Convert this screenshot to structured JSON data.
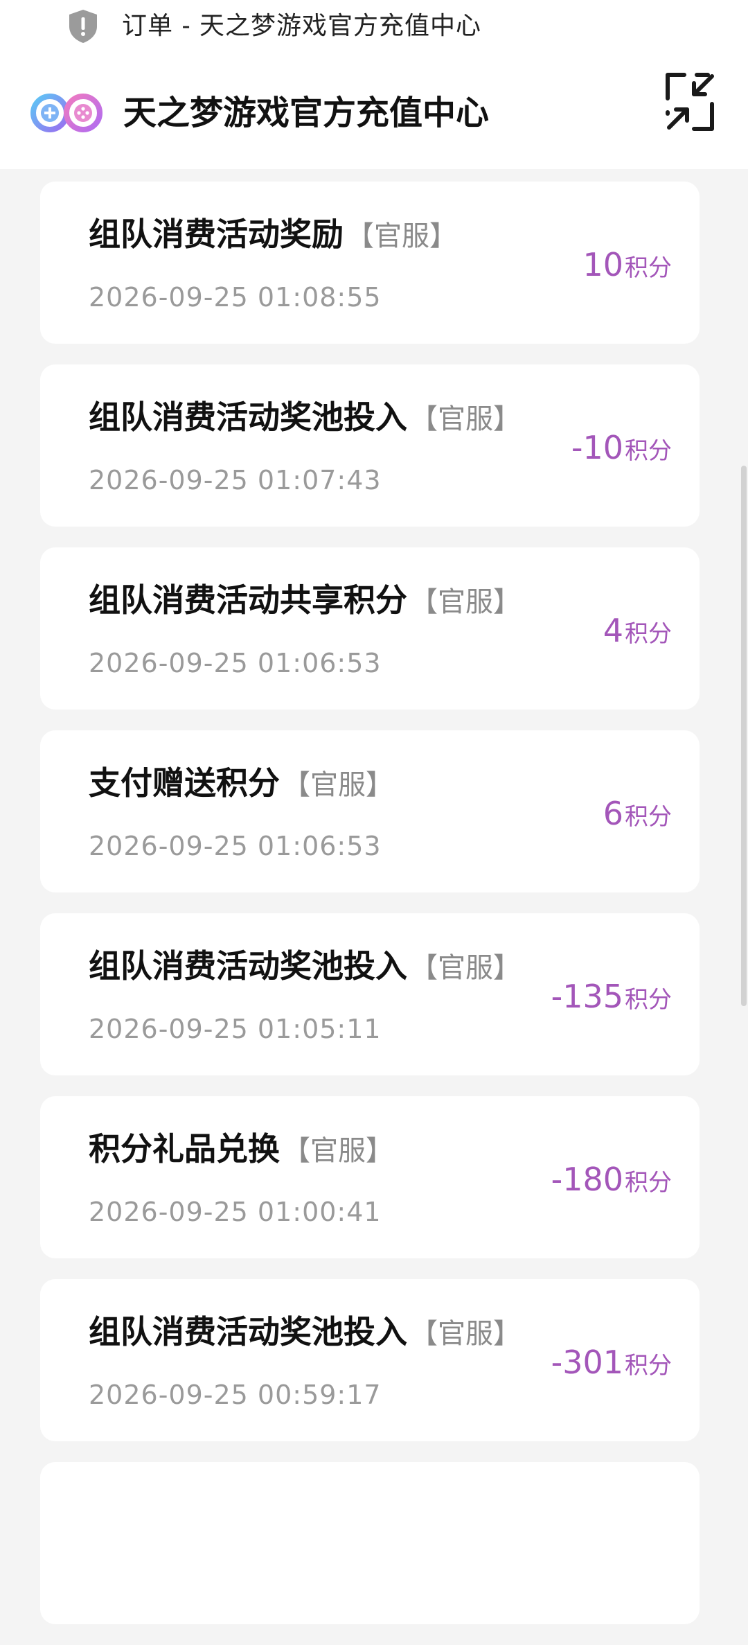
{
  "browser": {
    "title": "订单 - 天之梦游戏官方充值中心",
    "icon": "shield-icon"
  },
  "header": {
    "app_title": "天之梦游戏官方充值中心",
    "logo_icon": "gamepad-logo-icon",
    "collapse_icon": "collapse-arrows-icon"
  },
  "colors": {
    "amount": "#a356b9",
    "background": "#f4f4f4"
  },
  "orders": [
    {
      "name": "组队消费活动奖励",
      "tag": "【官服】",
      "time": "2026-09-25 01:08:55",
      "amount": "10",
      "unit": "积分"
    },
    {
      "name": "组队消费活动奖池投入",
      "tag": "【官服】",
      "time": "2026-09-25 01:07:43",
      "amount": "-10",
      "unit": "积分"
    },
    {
      "name": "组队消费活动共享积分",
      "tag": "【官服】",
      "time": "2026-09-25 01:06:53",
      "amount": "4",
      "unit": "积分"
    },
    {
      "name": "支付赠送积分",
      "tag": "【官服】",
      "time": "2026-09-25 01:06:53",
      "amount": "6",
      "unit": "积分"
    },
    {
      "name": "组队消费活动奖池投入",
      "tag": "【官服】",
      "time": "2026-09-25 01:05:11",
      "amount": "-135",
      "unit": "积分"
    },
    {
      "name": "积分礼品兑换",
      "tag": "【官服】",
      "time": "2026-09-25 01:00:41",
      "amount": "-180",
      "unit": "积分"
    },
    {
      "name": "组队消费活动奖池投入",
      "tag": "【官服】",
      "time": "2026-09-25 00:59:17",
      "amount": "-301",
      "unit": "积分"
    }
  ]
}
